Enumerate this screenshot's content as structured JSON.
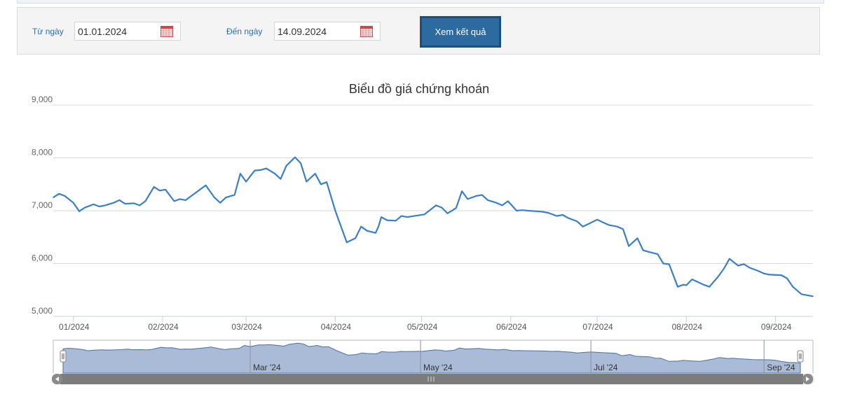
{
  "filters": {
    "from_label": "Từ ngày",
    "from_value": "01.01.2024",
    "to_label": "Đến ngày",
    "to_value": "14.09.2024",
    "submit_label": "Xem kết quả"
  },
  "chart_data": {
    "type": "line",
    "title": "Biểu đồ giá chứng khoán",
    "ylim": [
      5000,
      9000
    ],
    "yticks": [
      5000,
      6000,
      7000,
      8000,
      9000
    ],
    "ytick_labels": [
      "5,000",
      "6,000",
      "7,000",
      "8,000",
      "9,000"
    ],
    "xlim": [
      "2023-12-25",
      "2024-09-14"
    ],
    "xticks": [
      {
        "date": "2024-01-01",
        "label": "01/2024"
      },
      {
        "date": "2024-02-01",
        "label": "02/2024"
      },
      {
        "date": "2024-03-01",
        "label": "03/2024"
      },
      {
        "date": "2024-04-01",
        "label": "04/2024"
      },
      {
        "date": "2024-05-01",
        "label": "05/2024"
      },
      {
        "date": "2024-06-01",
        "label": "06/2024"
      },
      {
        "date": "2024-07-01",
        "label": "07/2024"
      },
      {
        "date": "2024-08-01",
        "label": "08/2024"
      },
      {
        "date": "2024-09-01",
        "label": "09/2024"
      }
    ],
    "grid": true,
    "legend": "none",
    "color": "#3a7fc7",
    "series": [
      {
        "x": [
          "2023-12-25",
          "2023-12-27",
          "2023-12-29",
          "2024-01-01",
          "2024-01-03",
          "2024-01-05",
          "2024-01-08",
          "2024-01-10",
          "2024-01-12",
          "2024-01-15",
          "2024-01-17",
          "2024-01-19",
          "2024-01-22",
          "2024-01-24",
          "2024-01-26",
          "2024-01-29",
          "2024-01-31",
          "2024-02-02",
          "2024-02-05",
          "2024-02-07",
          "2024-02-09",
          "2024-02-14",
          "2024-02-16",
          "2024-02-19",
          "2024-02-21",
          "2024-02-23",
          "2024-02-26",
          "2024-02-28",
          "2024-03-01",
          "2024-03-04",
          "2024-03-06",
          "2024-03-08",
          "2024-03-11",
          "2024-03-13",
          "2024-03-15",
          "2024-03-18",
          "2024-03-20",
          "2024-03-22",
          "2024-03-25",
          "2024-03-27",
          "2024-03-29",
          "2024-04-01",
          "2024-04-03",
          "2024-04-05",
          "2024-04-08",
          "2024-04-10",
          "2024-04-12",
          "2024-04-15",
          "2024-04-16",
          "2024-04-17",
          "2024-04-19",
          "2024-04-22",
          "2024-04-24",
          "2024-04-26",
          "2024-05-02",
          "2024-05-06",
          "2024-05-08",
          "2024-05-10",
          "2024-05-13",
          "2024-05-15",
          "2024-05-17",
          "2024-05-20",
          "2024-05-22",
          "2024-05-24",
          "2024-05-27",
          "2024-05-29",
          "2024-05-31",
          "2024-06-03",
          "2024-06-05",
          "2024-06-07",
          "2024-06-10",
          "2024-06-12",
          "2024-06-14",
          "2024-06-17",
          "2024-06-19",
          "2024-06-21",
          "2024-06-24",
          "2024-06-26",
          "2024-06-28",
          "2024-07-01",
          "2024-07-03",
          "2024-07-05",
          "2024-07-08",
          "2024-07-10",
          "2024-07-12",
          "2024-07-15",
          "2024-07-17",
          "2024-07-19",
          "2024-07-22",
          "2024-07-24",
          "2024-07-26",
          "2024-07-29",
          "2024-07-31",
          "2024-08-01",
          "2024-08-03",
          "2024-08-05",
          "2024-08-07",
          "2024-08-09",
          "2024-08-12",
          "2024-08-14",
          "2024-08-16",
          "2024-08-19",
          "2024-08-21",
          "2024-08-23",
          "2024-08-26",
          "2024-08-28",
          "2024-08-30",
          "2024-09-03",
          "2024-09-05",
          "2024-09-07",
          "2024-09-10",
          "2024-09-12",
          "2024-09-14"
        ],
        "y": [
          7250,
          7320,
          7280,
          7150,
          6990,
          7060,
          7120,
          7080,
          7100,
          7150,
          7200,
          7130,
          7140,
          7100,
          7180,
          7450,
          7380,
          7400,
          7180,
          7220,
          7200,
          7400,
          7480,
          7250,
          7150,
          7250,
          7300,
          7700,
          7550,
          7760,
          7770,
          7800,
          7700,
          7600,
          7850,
          8010,
          7900,
          7550,
          7700,
          7500,
          7540,
          7000,
          6700,
          6400,
          6480,
          6700,
          6620,
          6580,
          6700,
          6880,
          6820,
          6810,
          6900,
          6880,
          6930,
          7100,
          7060,
          6950,
          7050,
          7370,
          7220,
          7280,
          7300,
          7200,
          7150,
          7100,
          7180,
          7000,
          7010,
          7000,
          6990,
          6980,
          6960,
          6900,
          6920,
          6860,
          6800,
          6700,
          6750,
          6830,
          6780,
          6730,
          6700,
          6650,
          6330,
          6480,
          6250,
          6220,
          6180,
          6000,
          5990,
          5560,
          5600,
          5590,
          5700,
          5650,
          5600,
          5560,
          5750,
          5900,
          6090,
          5960,
          5990,
          5920,
          5860,
          5810,
          5790,
          5780,
          5720,
          5560,
          5420,
          5400,
          5380
        ]
      }
    ],
    "navigator": {
      "labels": [
        {
          "date": "2024-03-01",
          "label": "Mar '24"
        },
        {
          "date": "2024-05-01",
          "label": "May '24"
        },
        {
          "date": "2024-07-01",
          "label": "Jul '24"
        },
        {
          "date": "2024-09-01",
          "label": "Sep '24"
        }
      ]
    }
  }
}
